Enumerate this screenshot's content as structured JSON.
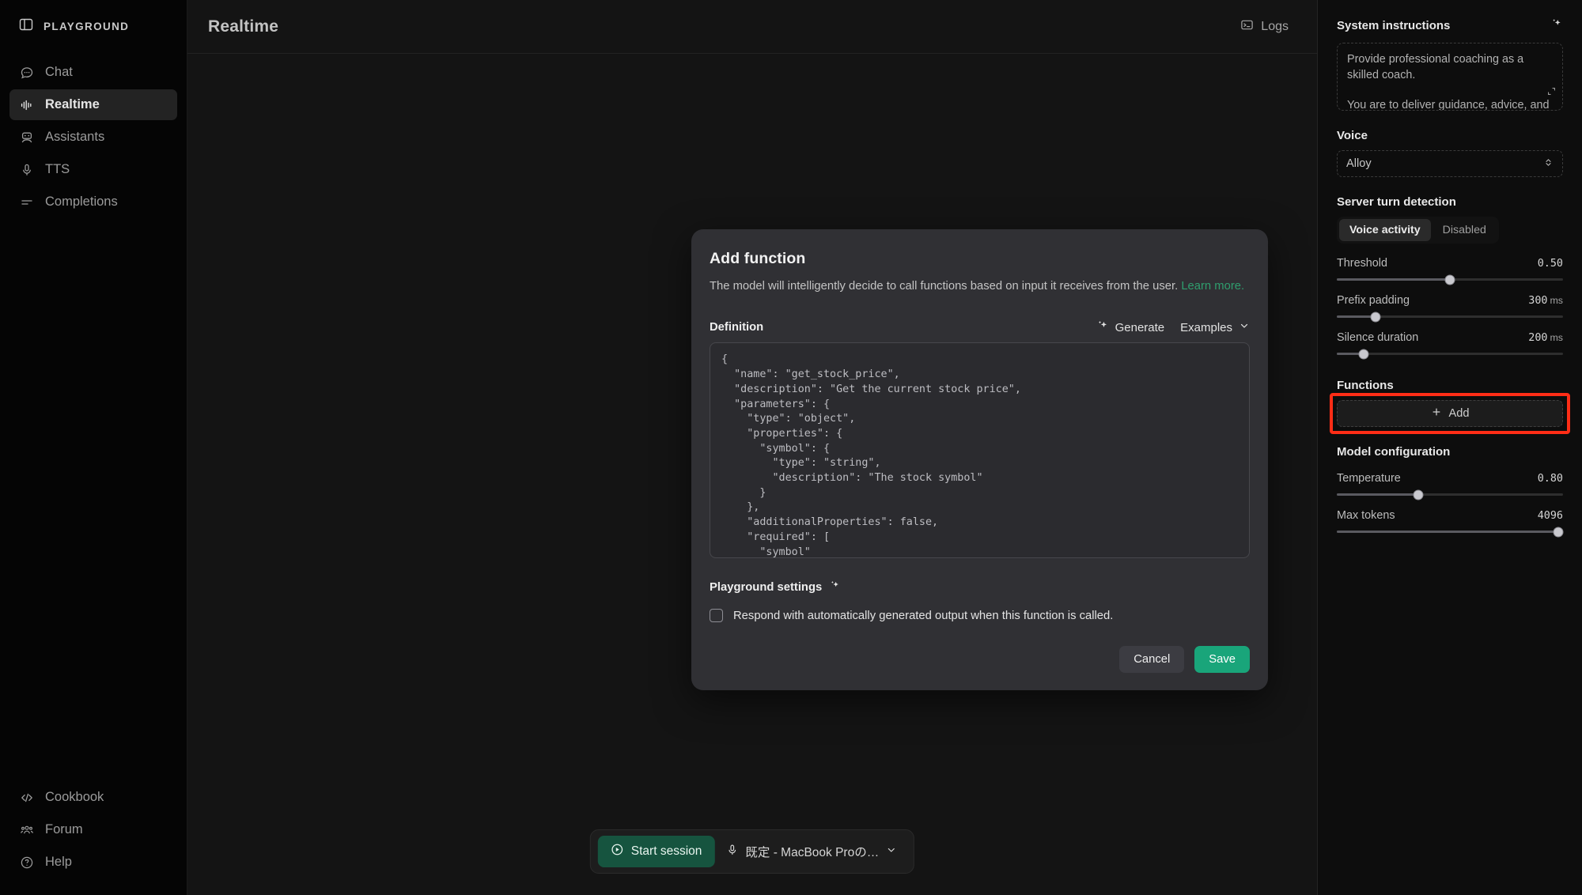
{
  "sidebar": {
    "brand": "PLAYGROUND",
    "brand_icon": "panel-icon",
    "items": [
      {
        "label": "Chat",
        "icon": "chat-bubble-icon",
        "active": false
      },
      {
        "label": "Realtime",
        "icon": "waveform-icon",
        "active": true
      },
      {
        "label": "Assistants",
        "icon": "robot-icon",
        "active": false
      },
      {
        "label": "TTS",
        "icon": "microphone-icon",
        "active": false
      },
      {
        "label": "Completions",
        "icon": "lines-icon",
        "active": false
      }
    ],
    "bottom_items": [
      {
        "label": "Cookbook",
        "icon": "code-brackets-icon"
      },
      {
        "label": "Forum",
        "icon": "people-icon"
      },
      {
        "label": "Help",
        "icon": "question-circle-icon"
      }
    ]
  },
  "topbar": {
    "title": "Realtime",
    "logs_label": "Logs",
    "logs_icon": "terminal-icon"
  },
  "modal": {
    "title": "Add function",
    "subtitle": "The model will intelligently decide to call functions based on input it receives from the user.",
    "learn_more": "Learn more.",
    "definition_label": "Definition",
    "generate_label": "Generate",
    "examples_label": "Examples",
    "code": "{\n  \"name\": \"get_stock_price\",\n  \"description\": \"Get the current stock price\",\n  \"parameters\": {\n    \"type\": \"object\",\n    \"properties\": {\n      \"symbol\": {\n        \"type\": \"string\",\n        \"description\": \"The stock symbol\"\n      }\n    },\n    \"additionalProperties\": false,\n    \"required\": [\n      \"symbol\"\n    ]\n  }\n}",
    "playground_settings_label": "Playground settings",
    "checkbox_label": "Respond with automatically generated output when this function is called.",
    "checkbox_checked": false,
    "cancel_label": "Cancel",
    "save_label": "Save"
  },
  "session_bar": {
    "start_label": "Start session",
    "mic_device": "既定 - MacBook Proの…"
  },
  "right_panel": {
    "system_instructions": {
      "title": "System instructions",
      "paragraph_1": "Provide professional coaching as a skilled coach.",
      "paragraph_2": "You are to deliver guidance, advice, and support with a friendly and empathetic"
    },
    "voice": {
      "label": "Voice",
      "value": "Alloy"
    },
    "turn_detection": {
      "label": "Server turn detection",
      "options": [
        "Voice activity",
        "Disabled"
      ],
      "selected": "Voice activity"
    },
    "sliders": [
      {
        "label": "Threshold",
        "value": "0.50",
        "unit": "",
        "percent": 50
      },
      {
        "label": "Prefix padding",
        "value": "300",
        "unit": "ms",
        "percent": 17
      },
      {
        "label": "Silence duration",
        "value": "200",
        "unit": "ms",
        "percent": 12
      }
    ],
    "functions": {
      "label": "Functions",
      "add_label": "Add",
      "highlighted": true
    },
    "model_configuration": {
      "label": "Model configuration",
      "sliders": [
        {
          "label": "Temperature",
          "value": "0.80",
          "unit": "",
          "percent": 36
        },
        {
          "label": "Max tokens",
          "value": "4096",
          "unit": "",
          "percent": 98
        }
      ]
    }
  },
  "colors": {
    "accent_green": "#19a57a",
    "link_green": "#2f9e6e",
    "highlight_red": "#ff2d16",
    "panel_bg": "#0d0d0d",
    "modal_bg": "#303034"
  }
}
